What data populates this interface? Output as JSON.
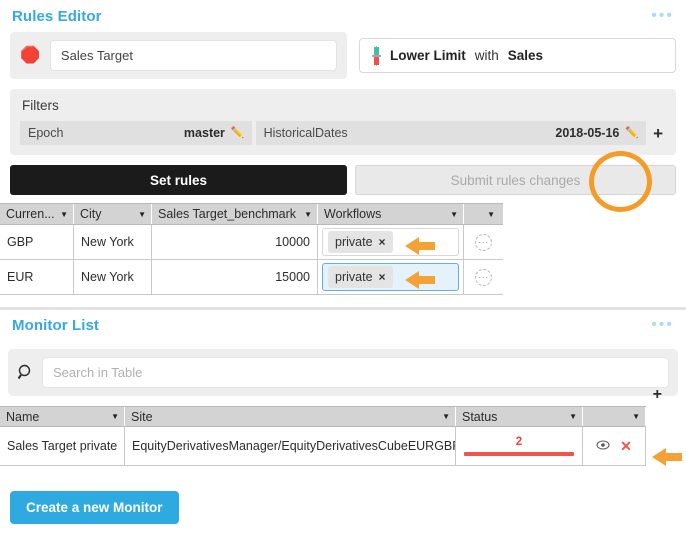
{
  "rules_editor": {
    "title": "Rules Editor",
    "menu_icon": "•••",
    "name_field": {
      "value": "Sales Target",
      "placeholder": "",
      "icon": "traffic-light"
    },
    "kpi": {
      "icon": "lower-limit",
      "label": "Lower Limit",
      "connector": "with",
      "measure": "Sales"
    },
    "filters": {
      "label": "Filters",
      "items": [
        {
          "name": "Epoch",
          "value": "master",
          "edit_icon": "pencil"
        },
        {
          "name": "HistoricalDates",
          "value": "2018-05-16",
          "edit_icon": "pencil"
        }
      ],
      "add_label": "+"
    },
    "buttons": {
      "set_rules": "Set rules",
      "submit_changes": "Submit rules changes"
    },
    "table": {
      "columns": [
        "Curren...",
        "City",
        "Sales Target_benchmark",
        "Workflows",
        ""
      ],
      "rows": [
        {
          "currency": "GBP",
          "city": "New York",
          "benchmark": "10000",
          "workflow_tag": "private",
          "tag_close": "×",
          "actions": "···",
          "selected": false
        },
        {
          "currency": "EUR",
          "city": "New York",
          "benchmark": "15000",
          "workflow_tag": "private",
          "tag_close": "×",
          "actions": "···",
          "selected": true
        }
      ]
    }
  },
  "monitor_list": {
    "title": "Monitor List",
    "menu_icon": "•••",
    "search": {
      "value": "",
      "placeholder": "Search in Table",
      "icon": "search-icon"
    },
    "table": {
      "columns": [
        "Name",
        "Site",
        "Status",
        ""
      ],
      "add_label": "+",
      "rows": [
        {
          "name": "Sales Target private",
          "site": "EquityDerivativesManager/EquityDerivativesCubeEURGBP",
          "status_count": "2",
          "view_icon": "◉",
          "delete_icon": "✕"
        }
      ]
    },
    "create_button": "Create a new Monitor"
  },
  "annotations": {
    "circle": {
      "shape": "ellipse",
      "color": "#f39c28"
    },
    "arrows": [
      {
        "target": "workflow-tag-row-1",
        "color": "#f4a136"
      },
      {
        "target": "workflow-tag-row-2",
        "color": "#f4a136"
      },
      {
        "target": "monitor-row-actions",
        "color": "#f4a136"
      }
    ]
  },
  "colors": {
    "accent_blue": "#35a9e0",
    "annotation_orange": "#f39c28",
    "status_red": "#f0544b",
    "dark_button": "#1b1b1b"
  }
}
